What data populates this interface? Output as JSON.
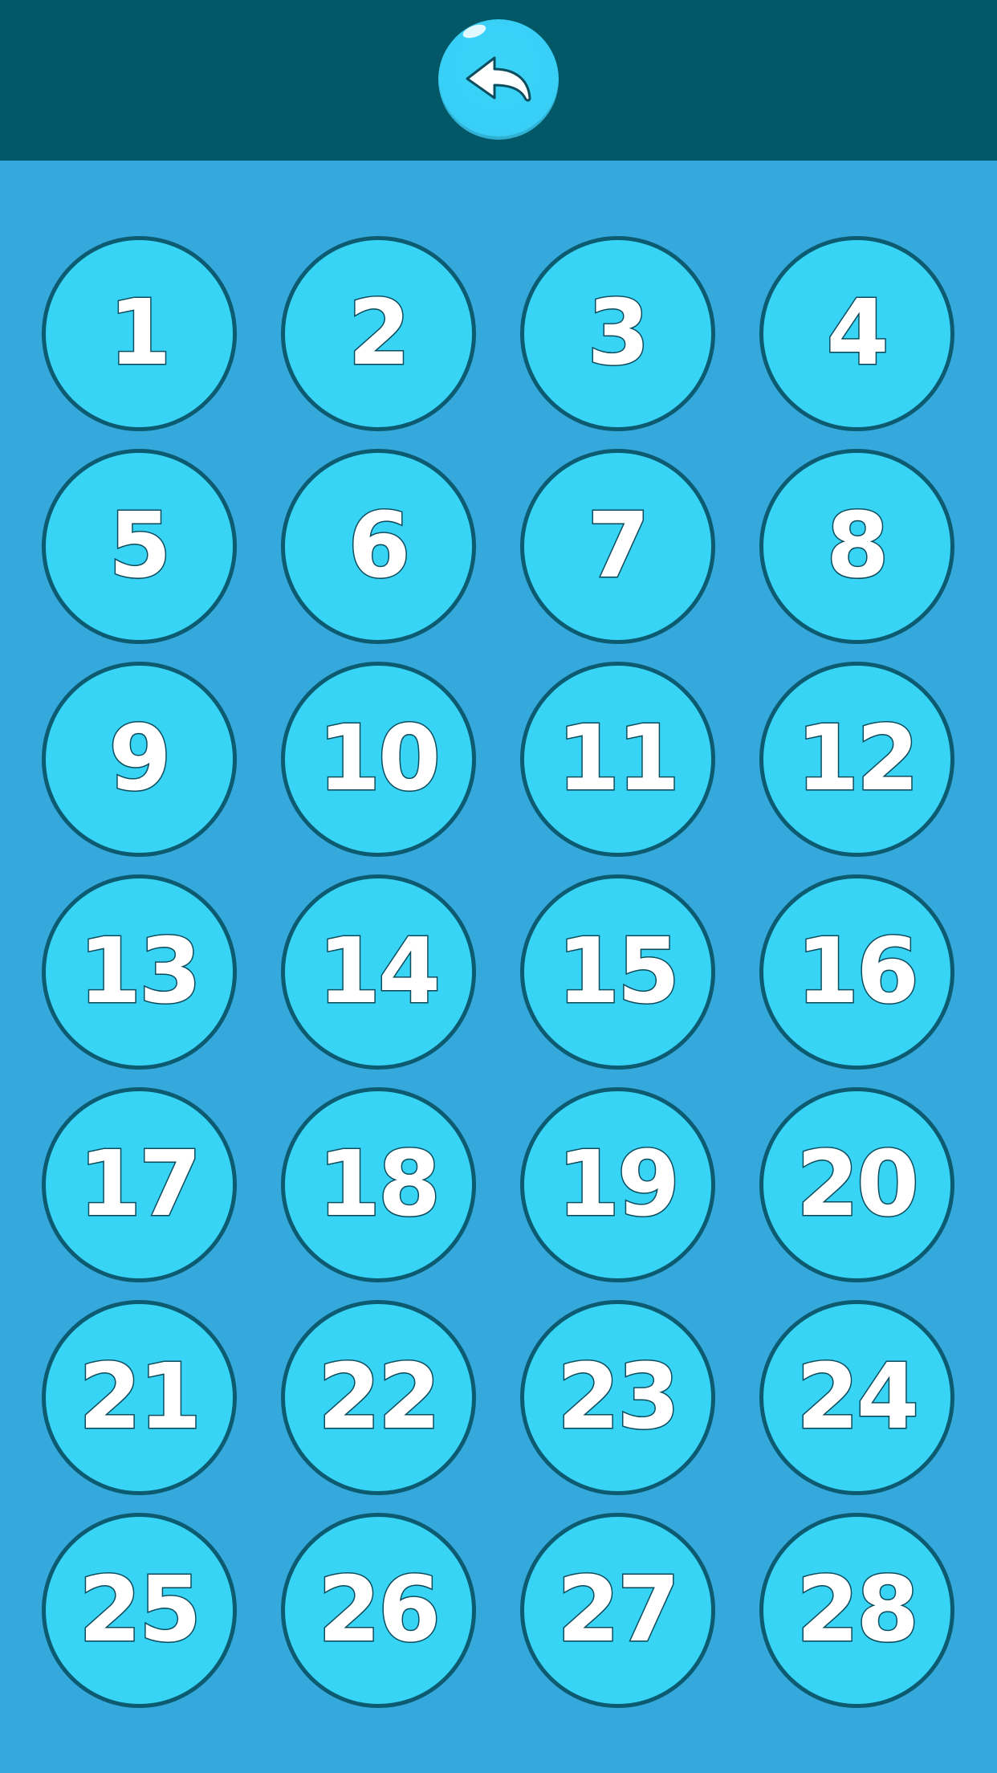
{
  "header": {
    "back_icon": "back-arrow-icon"
  },
  "levels": [
    {
      "label": "1"
    },
    {
      "label": "2"
    },
    {
      "label": "3"
    },
    {
      "label": "4"
    },
    {
      "label": "5"
    },
    {
      "label": "6"
    },
    {
      "label": "7"
    },
    {
      "label": "8"
    },
    {
      "label": "9"
    },
    {
      "label": "10"
    },
    {
      "label": "11"
    },
    {
      "label": "12"
    },
    {
      "label": "13"
    },
    {
      "label": "14"
    },
    {
      "label": "15"
    },
    {
      "label": "16"
    },
    {
      "label": "17"
    },
    {
      "label": "18"
    },
    {
      "label": "19"
    },
    {
      "label": "20"
    },
    {
      "label": "21"
    },
    {
      "label": "22"
    },
    {
      "label": "23"
    },
    {
      "label": "24"
    },
    {
      "label": "25"
    },
    {
      "label": "26"
    },
    {
      "label": "27"
    },
    {
      "label": "28"
    }
  ],
  "colors": {
    "background": "#35a8dc",
    "top_bar": "#035867",
    "button_fill": "#38d4f5",
    "button_border": "#0c5b70",
    "number_fill": "#ffffff",
    "number_outline": "#0c4d5e"
  }
}
